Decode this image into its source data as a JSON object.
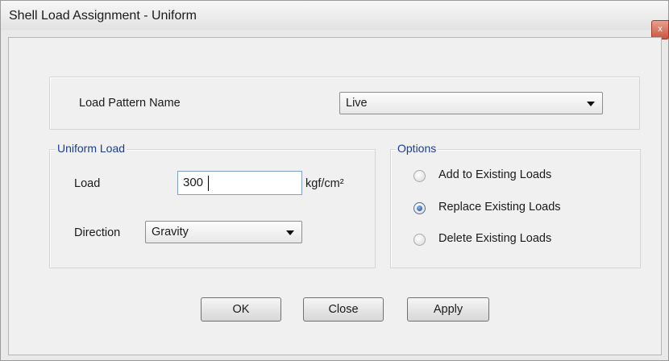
{
  "window": {
    "title": "Shell Load Assignment - Uniform",
    "close_glyph": "x"
  },
  "load_pattern": {
    "label": "Load Pattern Name",
    "value": "Live"
  },
  "uniform_load": {
    "legend": "Uniform Load",
    "load_label": "Load",
    "load_value": "300",
    "load_unit": "kgf/cm²",
    "direction_label": "Direction",
    "direction_value": "Gravity"
  },
  "options": {
    "legend": "Options",
    "items": [
      {
        "label": "Add to Existing Loads",
        "checked": false
      },
      {
        "label": "Replace Existing Loads",
        "checked": true
      },
      {
        "label": "Delete Existing Loads",
        "checked": false
      }
    ]
  },
  "buttons": {
    "ok": "OK",
    "close": "Close",
    "apply": "Apply"
  },
  "icons": {
    "close": "close-icon",
    "dropdown": "chevron-down-icon"
  }
}
